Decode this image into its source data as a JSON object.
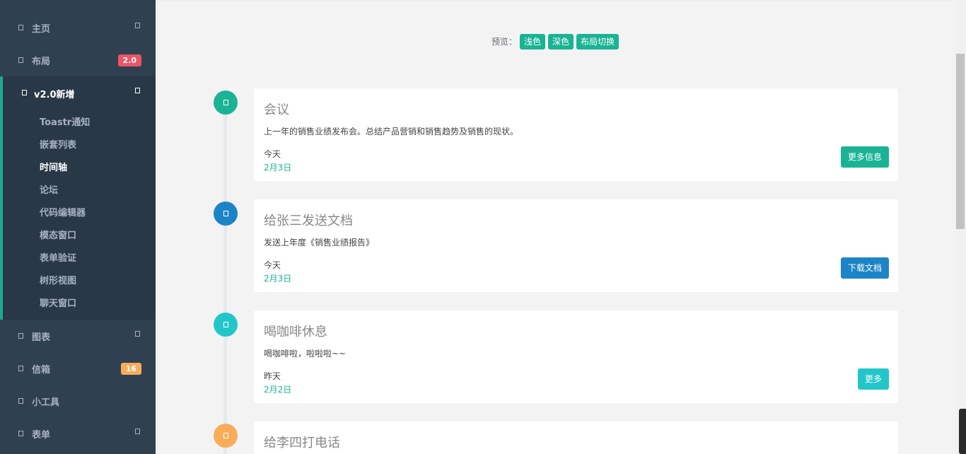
{
  "sidebar": {
    "items": [
      {
        "label": "主页"
      },
      {
        "label": "布局",
        "badge": "2.0"
      },
      {
        "label": "v2.0新增"
      },
      {
        "label": "图表"
      },
      {
        "label": "信箱",
        "badge": "16"
      },
      {
        "label": "小工具"
      },
      {
        "label": "表单"
      }
    ],
    "sub_items": [
      "Toastr通知",
      "嵌套列表",
      "时间轴",
      "论坛",
      "代码编辑器",
      "模态窗口",
      "表单验证",
      "树形视图",
      "聊天窗口"
    ]
  },
  "preview": {
    "label": "预览：",
    "buttons": [
      "浅色",
      "深色",
      "布局切换"
    ]
  },
  "timeline": [
    {
      "title": "会议",
      "desc": "上一年的销售业绩发布会。总结产品营销和销售趋势及销售的现状。",
      "when": "今天",
      "date": "2月3日",
      "button": "更多信息",
      "color": "#1ab394"
    },
    {
      "title": "给张三发送文档",
      "desc": "发送上年度《销售业绩报告》",
      "when": "今天",
      "date": "2月3日",
      "button": "下载文档",
      "color": "#1c84c6"
    },
    {
      "title": "喝咖啡休息",
      "desc": "喝咖啡啦，啦啦啦~~",
      "when": "昨天",
      "date": "2月2日",
      "button": "更多",
      "color": "#23c6c8"
    },
    {
      "title": "给李四打电话",
      "color": "#f8ac59"
    }
  ],
  "colors": {
    "sidebar_bg": "#2f4050",
    "accent": "#1ab394",
    "danger": "#ed5565",
    "warning": "#f8ac59"
  }
}
